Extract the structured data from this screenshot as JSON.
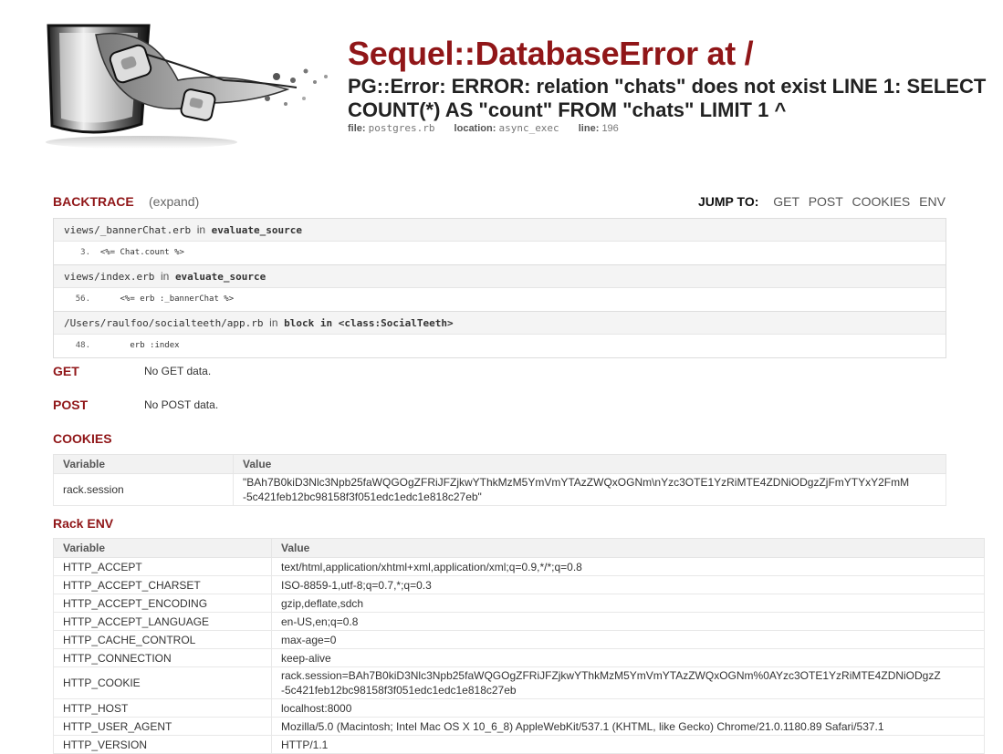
{
  "header": {
    "title": "Sequel::DatabaseError at  /",
    "message": "PG::Error: ERROR: relation \"chats\" does not exist LINE 1: SELECT COUNT(*) AS \"count\" FROM \"chats\" LIMIT 1 ^",
    "file_label": "file:",
    "file": "postgres.rb",
    "location_label": "location:",
    "location": "async_exec",
    "line_label": "line:",
    "line": "196"
  },
  "backtrace": {
    "heading": "BACKTRACE",
    "expand_label": "(expand)",
    "jump_label": "JUMP TO:",
    "jump_links": [
      "GET",
      "POST",
      "COOKIES",
      "ENV"
    ],
    "frames": [
      {
        "file": "views/_bannerChat.erb",
        "in": "in",
        "method": "evaluate_source",
        "line": "3.",
        "code": "<%= Chat.count %>"
      },
      {
        "file": "views/index.erb",
        "in": "in",
        "method": "evaluate_source",
        "line": "56.",
        "code": "    <%= erb :_bannerChat %>"
      },
      {
        "file": "/Users/raulfoo/socialteeth/app.rb",
        "in": "in",
        "method": "block in <class:SocialTeeth>",
        "line": "48.",
        "code": "      erb :index"
      }
    ]
  },
  "get": {
    "heading": "GET",
    "empty_text": "No GET data."
  },
  "post": {
    "heading": "POST",
    "empty_text": "No POST data."
  },
  "cookies": {
    "heading": "COOKIES",
    "col_variable": "Variable",
    "col_value": "Value",
    "rows": [
      {
        "name": "rack.session",
        "value_line1": "\"BAh7B0kiD3Nlc3Npb25faWQGOgZFRiJFZjkwYThkMzM5YmVmYTAzZWQxOGNm\\nYzc3OTE1YzRiMTE4ZDNiODgzZjFmYTYxY2FmM",
        "value_line2": "-5c421feb12bc98158f3f051edc1edc1e818c27eb\""
      }
    ]
  },
  "env": {
    "heading": "Rack ENV",
    "col_variable": "Variable",
    "col_value": "Value",
    "rows": [
      {
        "name": "HTTP_ACCEPT",
        "value": "text/html,application/xhtml+xml,application/xml;q=0.9,*/*;q=0.8"
      },
      {
        "name": "HTTP_ACCEPT_CHARSET",
        "value": "ISO-8859-1,utf-8;q=0.7,*;q=0.3"
      },
      {
        "name": "HTTP_ACCEPT_ENCODING",
        "value": "gzip,deflate,sdch"
      },
      {
        "name": "HTTP_ACCEPT_LANGUAGE",
        "value": "en-US,en;q=0.8"
      },
      {
        "name": "HTTP_CACHE_CONTROL",
        "value": "max-age=0"
      },
      {
        "name": "HTTP_CONNECTION",
        "value": "keep-alive"
      },
      {
        "name": "HTTP_COOKIE",
        "value": "rack.session=BAh7B0kiD3Nlc3Npb25faWQGOgZFRiJFZjkwYThkMzM5YmVmYTAzZWQxOGNm%0AYzc3OTE1YzRiMTE4ZDNiODgzZ",
        "value_line2": "-5c421feb12bc98158f3f051edc1edc1e818c27eb"
      },
      {
        "name": "HTTP_HOST",
        "value": "localhost:8000"
      },
      {
        "name": "HTTP_USER_AGENT",
        "value": "Mozilla/5.0 (Macintosh; Intel Mac OS X 10_6_8) AppleWebKit/537.1 (KHTML, like Gecko) Chrome/21.0.1180.89 Safari/537.1"
      },
      {
        "name": "HTTP_VERSION",
        "value": "HTTP/1.1"
      }
    ]
  },
  "colors": {
    "accent": "#901618",
    "header_bg": "#f4f4f4"
  }
}
